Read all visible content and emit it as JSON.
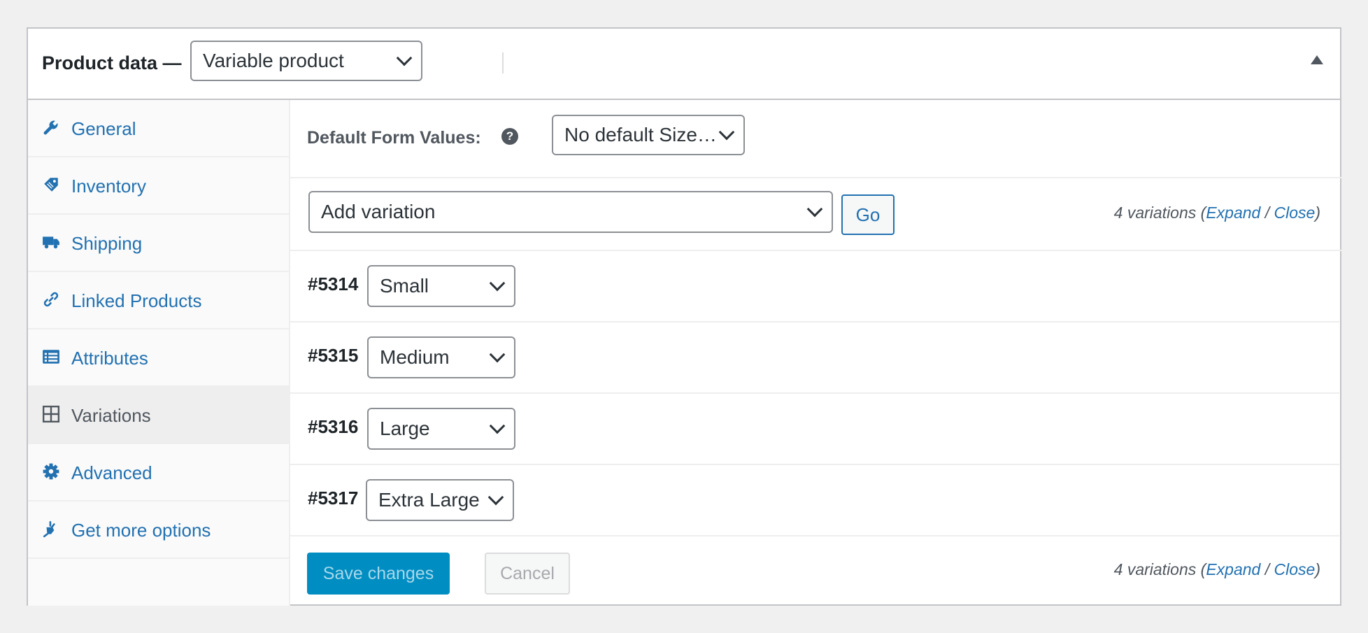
{
  "header": {
    "title": "Product data —",
    "product_type": "Variable product"
  },
  "tabs": [
    {
      "label": "General",
      "icon": "wrench-icon"
    },
    {
      "label": "Inventory",
      "icon": "tag-icon"
    },
    {
      "label": "Shipping",
      "icon": "truck-icon"
    },
    {
      "label": "Linked Products",
      "icon": "link-icon"
    },
    {
      "label": "Attributes",
      "icon": "list-view-icon"
    },
    {
      "label": "Variations",
      "icon": "grid-icon",
      "active": true
    },
    {
      "label": "Advanced",
      "icon": "gear-icon"
    },
    {
      "label": "Get more options",
      "icon": "plugin-icon"
    }
  ],
  "defaults": {
    "label": "Default Form Values:",
    "help": "?",
    "select_value": "No default Size…"
  },
  "add_variation": {
    "select_value": "Add variation",
    "go_label": "Go"
  },
  "counts": {
    "text": "4 variations",
    "open_paren": "(",
    "expand": "Expand",
    "slash": " / ",
    "close": "Close",
    "close_paren": ")"
  },
  "variations": [
    {
      "id": "#5314",
      "value": "Small"
    },
    {
      "id": "#5315",
      "value": "Medium"
    },
    {
      "id": "#5316",
      "value": "Large"
    },
    {
      "id": "#5317",
      "value": "Extra Large"
    }
  ],
  "footer": {
    "save_label": "Save changes",
    "cancel_label": "Cancel"
  },
  "colors": {
    "link": "#2271b1",
    "primary_button": "#008ec2",
    "border": "#c3c4c7"
  }
}
